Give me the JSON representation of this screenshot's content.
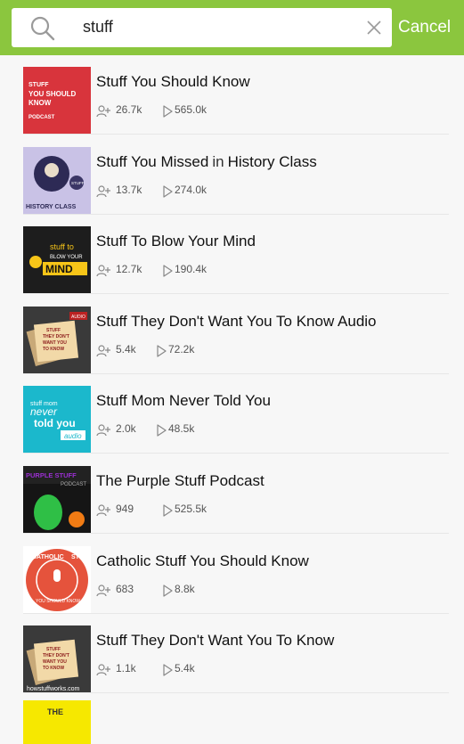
{
  "search": {
    "query": "stuff",
    "cancel_label": "Cancel"
  },
  "results": [
    {
      "title": "Stuff You Should Know",
      "subscribers": "26.7k",
      "plays": "565.0k",
      "art": {
        "bg": "#d8343c",
        "accent": "#ffffff",
        "lines": [
          "STUFF",
          "YOU SHOULD",
          "KNOW",
          "PODCAST"
        ]
      }
    },
    {
      "title_parts": [
        "Stuff You Missed",
        "in",
        "History Class"
      ],
      "subscribers": "13.7k",
      "plays": "274.0k",
      "art": {
        "bg": "#c9c2e6",
        "accent": "#3b3666",
        "lines": [
          "STUFF",
          "HISTORY CLASS"
        ]
      }
    },
    {
      "title": "Stuff To Blow Your Mind",
      "subscribers": "12.7k",
      "plays": "190.4k",
      "art": {
        "bg": "#1d1d1d",
        "accent": "#f7c518",
        "lines": [
          "stuff to",
          "BLOW YOUR",
          "MIND"
        ]
      }
    },
    {
      "title": "Stuff They Don't Want You To Know Audio",
      "subscribers": "5.4k",
      "plays": "72.2k",
      "art": {
        "bg": "#3a3a3a",
        "accent": "#f2d9a8",
        "lines": [
          "STUFF",
          "THEY DON'T",
          "WANT YOU",
          "TO KNOW",
          "AUDIO"
        ]
      }
    },
    {
      "title": "Stuff Mom Never Told You",
      "subscribers": "2.0k",
      "plays": "48.5k",
      "art": {
        "bg": "#1bb8cc",
        "accent": "#ffffff",
        "lines": [
          "stuff mom",
          "never",
          "told you",
          "audio"
        ]
      }
    },
    {
      "title": "The Purple Stuff Podcast",
      "subscribers": "949",
      "plays": "525.5k",
      "art": {
        "bg": "#151515",
        "accent": "#9a2fd1",
        "lines": [
          "PURPLE STUFF",
          "PODCAST"
        ]
      }
    },
    {
      "title": "Catholic Stuff You Should Know",
      "subscribers": "683",
      "plays": "8.8k",
      "art": {
        "bg": "#ffffff",
        "accent": "#e5533c",
        "lines": [
          "CATHOLIC",
          "STUFF",
          "YOU SHOULD KNOW"
        ]
      }
    },
    {
      "title": "Stuff They Don't Want You To Know",
      "subscribers": "1.1k",
      "plays": "5.4k",
      "art": {
        "bg": "#3a3a3a",
        "accent": "#f2d9a8",
        "lines": [
          "STUFF",
          "THEY DON'T",
          "WANT YOU",
          "TO KNOW",
          "howstuffworks.com"
        ]
      }
    }
  ],
  "partial_item": {
    "art_text": "THE"
  }
}
